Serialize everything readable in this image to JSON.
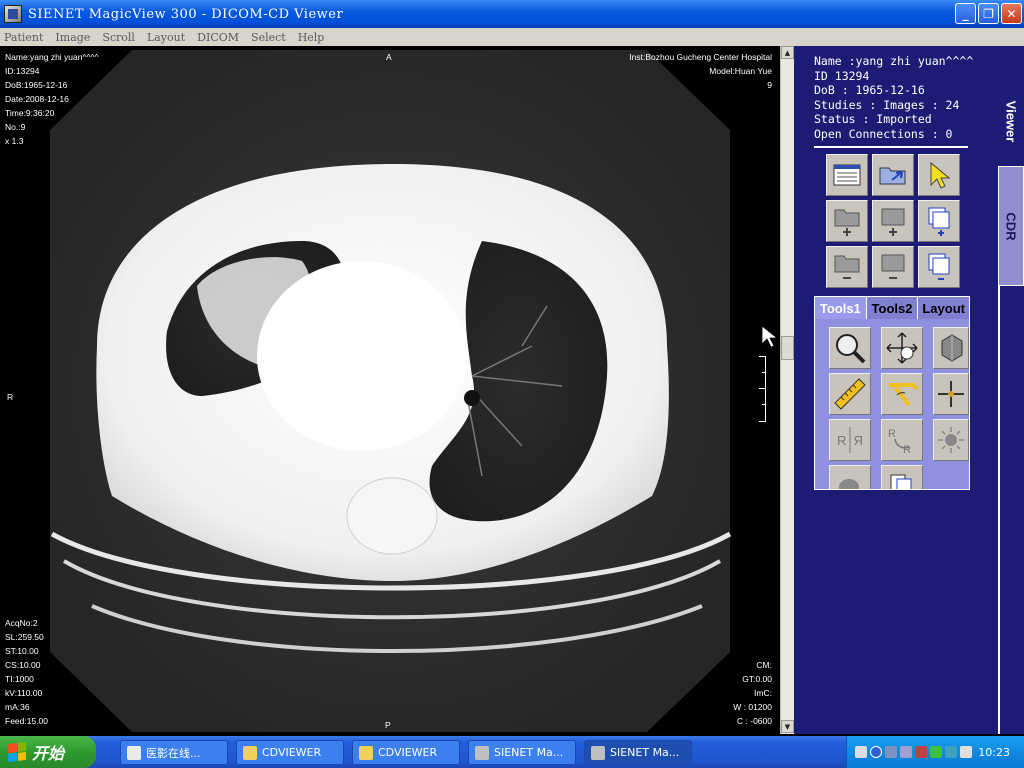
{
  "window": {
    "title": "SIENET MagicView 300  - DICOM-CD Viewer"
  },
  "menu": [
    "Patient",
    "Image",
    "Scroll",
    "Layout",
    "DICOM",
    "Select",
    "Help"
  ],
  "overlay": {
    "top_left": [
      "Name:yang zhi yuan^^^^",
      "ID:13294",
      "DoB:1965-12-16",
      "Date:2008-12-16",
      "Time:9:36:20",
      "No.:9",
      "x 1.3"
    ],
    "top_right": [
      "Inst:Bozhou Gucheng Center Hospital",
      "Model:Huan Yue",
      "9"
    ],
    "bottom_left": [
      "AcqNo:2",
      "SL:259.50",
      "ST:10.00",
      "CS:10.00",
      "TI:1000",
      "kV:110.00",
      "mA:36",
      "Feed:15.00"
    ],
    "bottom_right": [
      "CM:",
      "GT:0.00",
      "ImC:",
      "W : 01200",
      "C : -0600"
    ],
    "orient_top": "A",
    "orient_bottom": "P",
    "orient_left": "R"
  },
  "patient": {
    "name": "Name :yang zhi yuan^^^^",
    "id": "ID 13294",
    "dob": "DoB : 1965-12-16",
    "studies": "Studies : Images : 24",
    "status": "Status : Imported",
    "connections": "Open Connections : 0"
  },
  "side_tabs": {
    "viewer": "Viewer",
    "cdr": "CDR"
  },
  "tool_tabs": [
    "Tools1",
    "Tools2",
    "Layout"
  ],
  "taskbar": {
    "start": "开始",
    "tasks": [
      "医影在线...",
      "CDVIEWER",
      "CDVIEWER",
      "SIENET Ma...",
      "SIENET Ma..."
    ],
    "clock": "10:23"
  },
  "colors": {
    "panel": "#1c1c74",
    "tools_bg": "#9090e0",
    "cdr_tab": "#8f8fd0"
  }
}
